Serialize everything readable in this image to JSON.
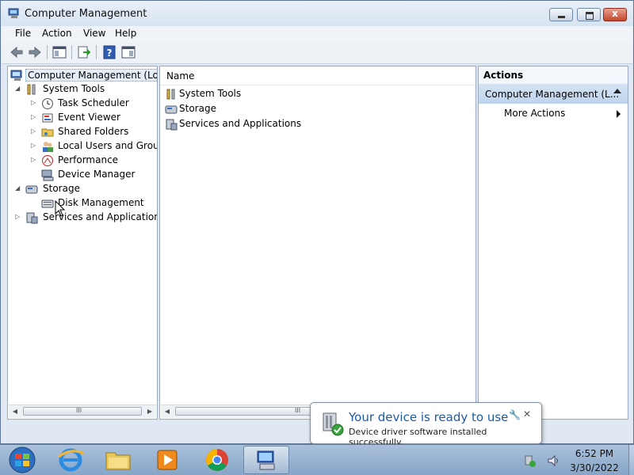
{
  "window": {
    "title": "Computer Management",
    "close_glyph": "x"
  },
  "menu": [
    "File",
    "Action",
    "View",
    "Help"
  ],
  "toolbar": {
    "icons": [
      "back-arrow-icon",
      "forward-arrow-icon",
      "show-hide-console-tree-icon",
      "export-list-icon",
      "help-icon",
      "show-hide-action-pane-icon"
    ]
  },
  "tree": {
    "root": "Computer Management (Local",
    "items": [
      {
        "label": "System Tools",
        "icon": "system-tools-icon"
      },
      {
        "label": "Task Scheduler",
        "icon": "clock-icon"
      },
      {
        "label": "Event Viewer",
        "icon": "event-viewer-icon"
      },
      {
        "label": "Shared Folders",
        "icon": "shared-folders-icon"
      },
      {
        "label": "Local Users and Groups",
        "icon": "users-icon"
      },
      {
        "label": "Performance",
        "icon": "performance-icon"
      },
      {
        "label": "Device Manager",
        "icon": "device-manager-icon"
      },
      {
        "label": "Storage",
        "icon": "storage-icon"
      },
      {
        "label": "Disk Management",
        "icon": "disk-icon"
      },
      {
        "label": "Services and Applications",
        "icon": "services-icon"
      }
    ],
    "scroll_grip": "III"
  },
  "list": {
    "header": "Name",
    "rows": [
      "System Tools",
      "Storage",
      "Services and Applications"
    ],
    "scroll_grip": "III"
  },
  "actions": {
    "header": "Actions",
    "section": "Computer Management (L...",
    "more": "More Actions"
  },
  "balloon": {
    "title": "Your device is ready to use",
    "message": "Device driver software installed successfully.",
    "options_glyph": "🔧",
    "close_glyph": "✕"
  },
  "taskbar": {
    "time": "6:52 PM",
    "date": "3/30/2022",
    "apps": [
      "internet-explorer-icon",
      "file-explorer-icon",
      "media-player-icon",
      "chrome-icon",
      "computer-management-icon"
    ]
  }
}
